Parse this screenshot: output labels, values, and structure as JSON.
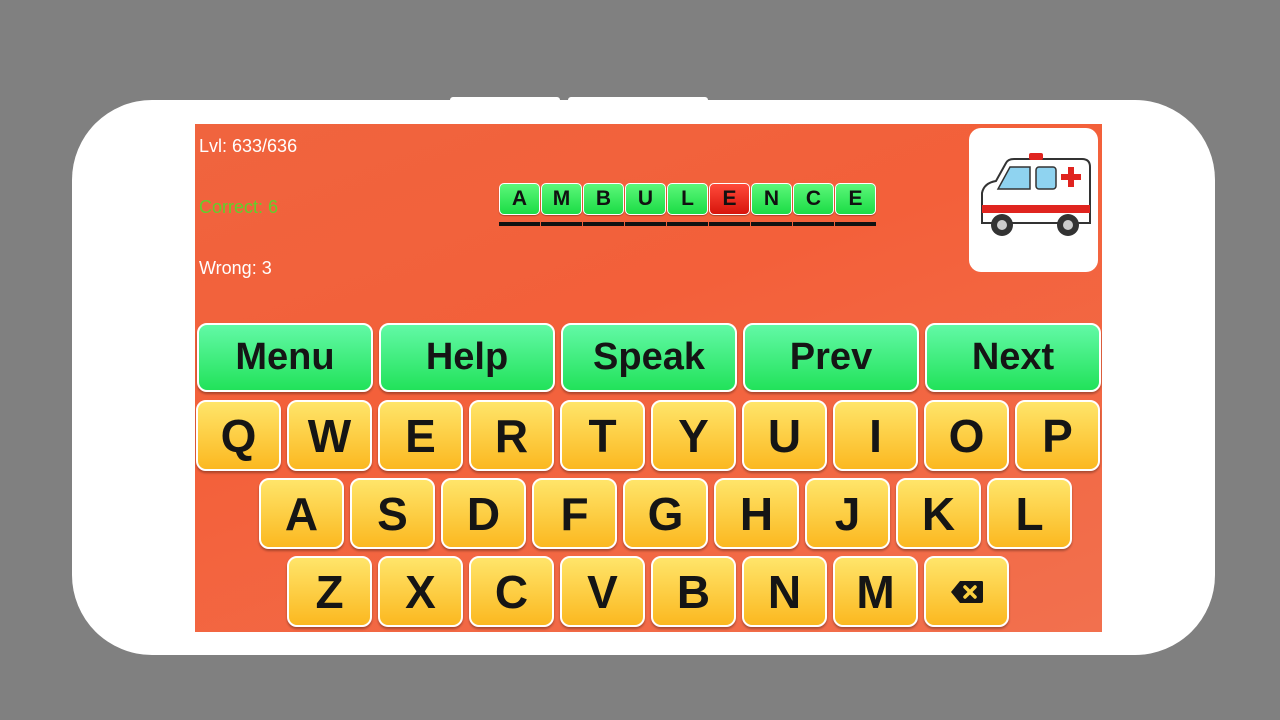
{
  "stats": {
    "level": "Lvl: 633/636",
    "correct": "Correct: 6",
    "wrong": "Wrong: 3",
    "correct_color": "#5fd12c"
  },
  "word": {
    "tiles": [
      {
        "ch": "A",
        "ok": true
      },
      {
        "ch": "M",
        "ok": true
      },
      {
        "ch": "B",
        "ok": true
      },
      {
        "ch": "U",
        "ok": true
      },
      {
        "ch": "L",
        "ok": true
      },
      {
        "ch": "E",
        "ok": false
      },
      {
        "ch": "N",
        "ok": true
      },
      {
        "ch": "C",
        "ok": true
      },
      {
        "ch": "E",
        "ok": true
      }
    ]
  },
  "picture": {
    "icon": "ambulance-icon"
  },
  "buttons": [
    "Menu",
    "Help",
    "Speak",
    "Prev",
    "Next"
  ],
  "keyboard": {
    "rows": [
      [
        "Q",
        "W",
        "E",
        "R",
        "T",
        "Y",
        "U",
        "I",
        "O",
        "P"
      ],
      [
        "A",
        "S",
        "D",
        "F",
        "G",
        "H",
        "J",
        "K",
        "L"
      ],
      [
        "Z",
        "X",
        "C",
        "V",
        "B",
        "N",
        "M"
      ]
    ],
    "backspace_icon": "backspace-icon"
  }
}
